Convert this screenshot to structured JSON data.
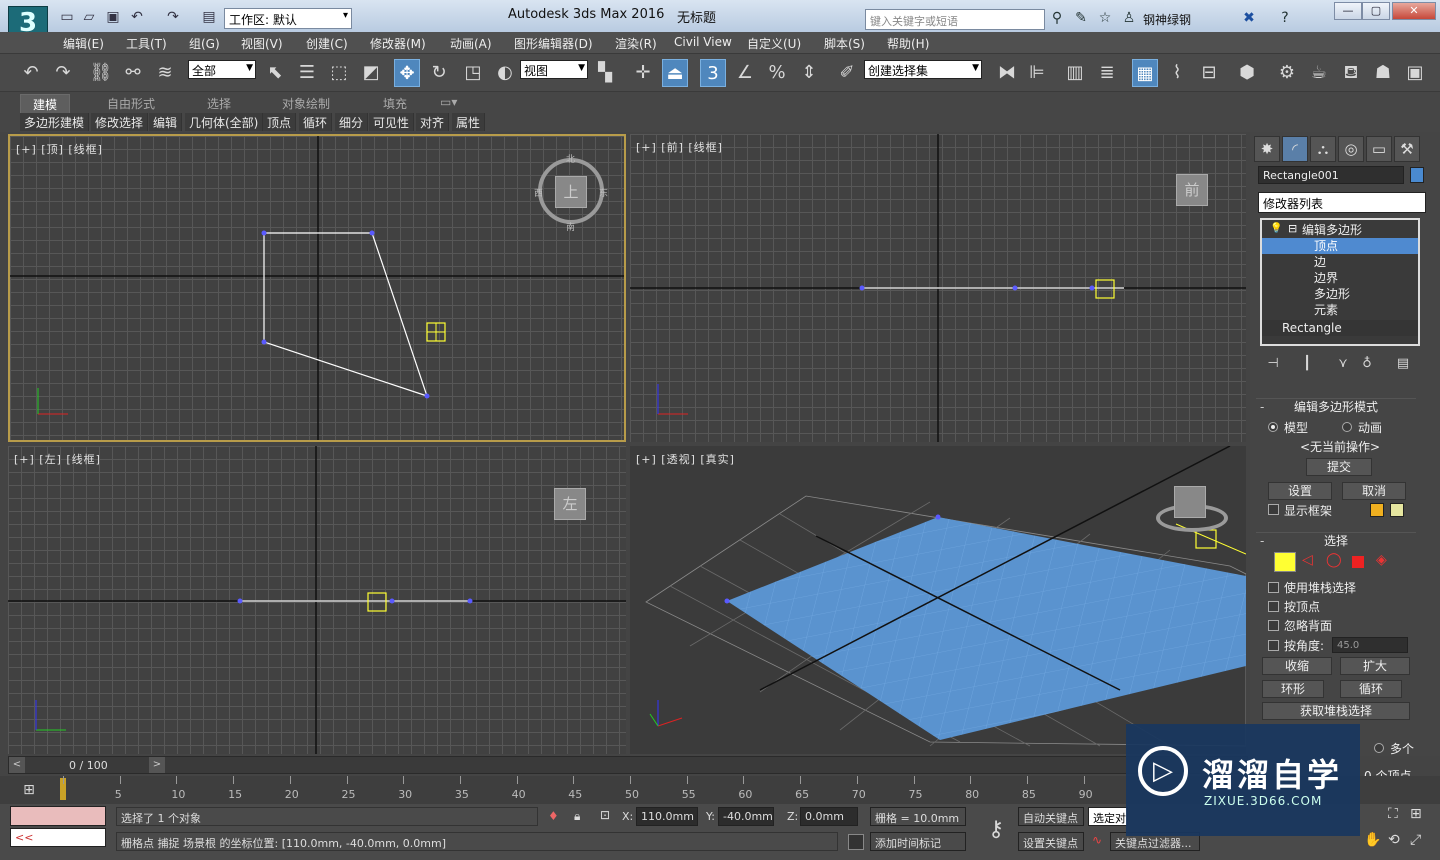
{
  "titlebar": {
    "logo": "MAX",
    "workspace": "工作区: 默认",
    "app_title": "Autodesk 3ds Max 2016",
    "doc_title": "无标题",
    "search_placeholder": "键入关键字或短语",
    "user": "钢神绿钢"
  },
  "menus": [
    "编辑(E)",
    "工具(T)",
    "组(G)",
    "视图(V)",
    "创建(C)",
    "修改器(M)",
    "动画(A)",
    "图形编辑器(D)",
    "渲染(R)",
    "Civil View",
    "自定义(U)",
    "脚本(S)",
    "帮助(H)"
  ],
  "toolbar": {
    "selection_filter": "全部",
    "ref_coord": "视图",
    "snap_number": "3",
    "named_selection": "创建选择集"
  },
  "ribbon": {
    "tabs": [
      "建模",
      "自由形式",
      "选择",
      "对象绘制",
      "填充"
    ],
    "sub": [
      "多边形建模",
      "修改选择",
      "编辑",
      "几何体(全部)",
      "顶点",
      "循环",
      "细分",
      "可见性",
      "对齐",
      "属性"
    ]
  },
  "viewports": {
    "top": "[+] [顶] [线框]",
    "front": "[+] [前] [线框]",
    "left": "[+] [左] [线框]",
    "persp": "[+] [透视] [真实]",
    "cube_top": "上",
    "cube_front": "前",
    "cube_left": "左",
    "compass_n": "北",
    "compass_s": "南",
    "compass_e": "东",
    "compass_w": "西"
  },
  "timeline": {
    "frame": "0 / 100",
    "ticks": [
      "0",
      "5",
      "10",
      "15",
      "20",
      "25",
      "30",
      "35",
      "40",
      "45",
      "50",
      "55",
      "60",
      "65",
      "70",
      "75",
      "80",
      "85",
      "90"
    ]
  },
  "status": {
    "selected": "选择了 1 个对象",
    "prompt": "栅格点 捕捉 场景根 的坐标位置: [110.0mm, -40.0mm, 0.0mm]",
    "x_label": "X:",
    "x": "110.0mm",
    "y_label": "Y:",
    "y": "-40.0mm",
    "z_label": "Z:",
    "z": "0.0mm",
    "grid": "栅格 = 10.0mm",
    "auto_key": "自动关键点",
    "set_key": "设置关键点",
    "selected_obj": "选定对",
    "key_filter": "关键点过滤器...",
    "add_time_tag": "添加时间标记",
    "maxscript": "<<"
  },
  "command_panel": {
    "object_name": "Rectangle001",
    "modifier_list": "修改器列表",
    "stack": [
      "编辑多边形",
      "顶点",
      "边",
      "边界",
      "多边形",
      "元素",
      "Rectangle"
    ],
    "edit_poly_mode": {
      "title": "编辑多边形模式",
      "model": "模型",
      "animate": "动画",
      "no_op": "<无当前操作>",
      "commit": "提交",
      "settings": "设置",
      "cancel": "取消",
      "show_cage": "显示框架"
    },
    "selection": {
      "title": "选择",
      "use_stack": "使用堆栈选择",
      "by_vertex": "按顶点",
      "ignore_backface": "忽略背面",
      "by_angle": "按角度:",
      "angle": "45.0",
      "shrink": "收缩",
      "grow": "扩大",
      "ring": "环形",
      "loop": "循环",
      "get_stack": "获取堆栈选择",
      "multi": "多个",
      "vertex_count": "0 个顶点"
    }
  },
  "watermark": {
    "text": "溜溜自学",
    "url": "ZIXUE.3D66.COM"
  },
  "colors": {
    "accent": "#4f8ad0",
    "active_vp_border": "#b89c4a",
    "plane": "#5a93cf"
  }
}
